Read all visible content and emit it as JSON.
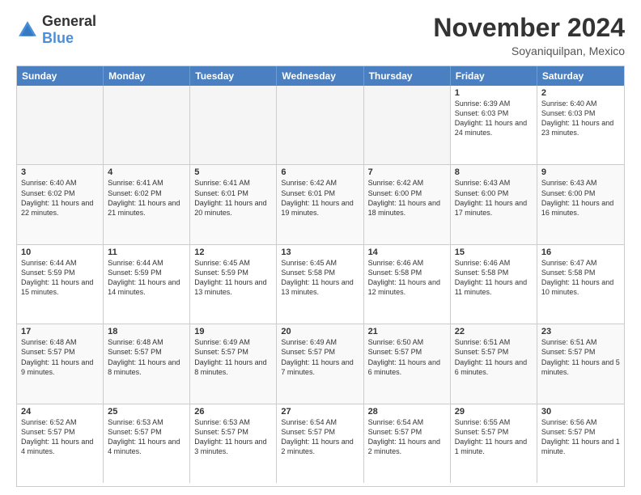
{
  "logo": {
    "general": "General",
    "blue": "Blue"
  },
  "header": {
    "month": "November 2024",
    "location": "Soyaniquilpan, Mexico"
  },
  "weekdays": [
    "Sunday",
    "Monday",
    "Tuesday",
    "Wednesday",
    "Thursday",
    "Friday",
    "Saturday"
  ],
  "rows": [
    {
      "cells": [
        {
          "day": "",
          "info": "",
          "empty": true
        },
        {
          "day": "",
          "info": "",
          "empty": true
        },
        {
          "day": "",
          "info": "",
          "empty": true
        },
        {
          "day": "",
          "info": "",
          "empty": true
        },
        {
          "day": "",
          "info": "",
          "empty": true
        },
        {
          "day": "1",
          "info": "Sunrise: 6:39 AM\nSunset: 6:03 PM\nDaylight: 11 hours and 24 minutes.",
          "empty": false
        },
        {
          "day": "2",
          "info": "Sunrise: 6:40 AM\nSunset: 6:03 PM\nDaylight: 11 hours and 23 minutes.",
          "empty": false
        }
      ]
    },
    {
      "cells": [
        {
          "day": "3",
          "info": "Sunrise: 6:40 AM\nSunset: 6:02 PM\nDaylight: 11 hours and 22 minutes.",
          "empty": false
        },
        {
          "day": "4",
          "info": "Sunrise: 6:41 AM\nSunset: 6:02 PM\nDaylight: 11 hours and 21 minutes.",
          "empty": false
        },
        {
          "day": "5",
          "info": "Sunrise: 6:41 AM\nSunset: 6:01 PM\nDaylight: 11 hours and 20 minutes.",
          "empty": false
        },
        {
          "day": "6",
          "info": "Sunrise: 6:42 AM\nSunset: 6:01 PM\nDaylight: 11 hours and 19 minutes.",
          "empty": false
        },
        {
          "day": "7",
          "info": "Sunrise: 6:42 AM\nSunset: 6:00 PM\nDaylight: 11 hours and 18 minutes.",
          "empty": false
        },
        {
          "day": "8",
          "info": "Sunrise: 6:43 AM\nSunset: 6:00 PM\nDaylight: 11 hours and 17 minutes.",
          "empty": false
        },
        {
          "day": "9",
          "info": "Sunrise: 6:43 AM\nSunset: 6:00 PM\nDaylight: 11 hours and 16 minutes.",
          "empty": false
        }
      ]
    },
    {
      "cells": [
        {
          "day": "10",
          "info": "Sunrise: 6:44 AM\nSunset: 5:59 PM\nDaylight: 11 hours and 15 minutes.",
          "empty": false
        },
        {
          "day": "11",
          "info": "Sunrise: 6:44 AM\nSunset: 5:59 PM\nDaylight: 11 hours and 14 minutes.",
          "empty": false
        },
        {
          "day": "12",
          "info": "Sunrise: 6:45 AM\nSunset: 5:59 PM\nDaylight: 11 hours and 13 minutes.",
          "empty": false
        },
        {
          "day": "13",
          "info": "Sunrise: 6:45 AM\nSunset: 5:58 PM\nDaylight: 11 hours and 13 minutes.",
          "empty": false
        },
        {
          "day": "14",
          "info": "Sunrise: 6:46 AM\nSunset: 5:58 PM\nDaylight: 11 hours and 12 minutes.",
          "empty": false
        },
        {
          "day": "15",
          "info": "Sunrise: 6:46 AM\nSunset: 5:58 PM\nDaylight: 11 hours and 11 minutes.",
          "empty": false
        },
        {
          "day": "16",
          "info": "Sunrise: 6:47 AM\nSunset: 5:58 PM\nDaylight: 11 hours and 10 minutes.",
          "empty": false
        }
      ]
    },
    {
      "cells": [
        {
          "day": "17",
          "info": "Sunrise: 6:48 AM\nSunset: 5:57 PM\nDaylight: 11 hours and 9 minutes.",
          "empty": false
        },
        {
          "day": "18",
          "info": "Sunrise: 6:48 AM\nSunset: 5:57 PM\nDaylight: 11 hours and 8 minutes.",
          "empty": false
        },
        {
          "day": "19",
          "info": "Sunrise: 6:49 AM\nSunset: 5:57 PM\nDaylight: 11 hours and 8 minutes.",
          "empty": false
        },
        {
          "day": "20",
          "info": "Sunrise: 6:49 AM\nSunset: 5:57 PM\nDaylight: 11 hours and 7 minutes.",
          "empty": false
        },
        {
          "day": "21",
          "info": "Sunrise: 6:50 AM\nSunset: 5:57 PM\nDaylight: 11 hours and 6 minutes.",
          "empty": false
        },
        {
          "day": "22",
          "info": "Sunrise: 6:51 AM\nSunset: 5:57 PM\nDaylight: 11 hours and 6 minutes.",
          "empty": false
        },
        {
          "day": "23",
          "info": "Sunrise: 6:51 AM\nSunset: 5:57 PM\nDaylight: 11 hours and 5 minutes.",
          "empty": false
        }
      ]
    },
    {
      "cells": [
        {
          "day": "24",
          "info": "Sunrise: 6:52 AM\nSunset: 5:57 PM\nDaylight: 11 hours and 4 minutes.",
          "empty": false
        },
        {
          "day": "25",
          "info": "Sunrise: 6:53 AM\nSunset: 5:57 PM\nDaylight: 11 hours and 4 minutes.",
          "empty": false
        },
        {
          "day": "26",
          "info": "Sunrise: 6:53 AM\nSunset: 5:57 PM\nDaylight: 11 hours and 3 minutes.",
          "empty": false
        },
        {
          "day": "27",
          "info": "Sunrise: 6:54 AM\nSunset: 5:57 PM\nDaylight: 11 hours and 2 minutes.",
          "empty": false
        },
        {
          "day": "28",
          "info": "Sunrise: 6:54 AM\nSunset: 5:57 PM\nDaylight: 11 hours and 2 minutes.",
          "empty": false
        },
        {
          "day": "29",
          "info": "Sunrise: 6:55 AM\nSunset: 5:57 PM\nDaylight: 11 hours and 1 minute.",
          "empty": false
        },
        {
          "day": "30",
          "info": "Sunrise: 6:56 AM\nSunset: 5:57 PM\nDaylight: 11 hours and 1 minute.",
          "empty": false
        }
      ]
    }
  ]
}
